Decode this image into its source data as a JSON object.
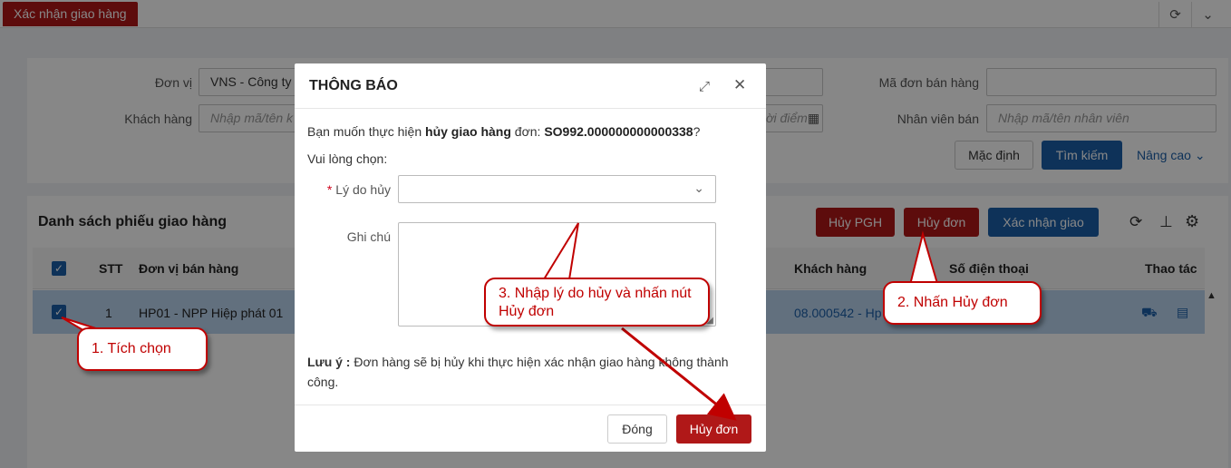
{
  "tabbar": {
    "active_tab": "Xác nhận giao hàng",
    "refresh_icon": "refresh-icon",
    "chevron_icon": "chevron-down-icon"
  },
  "filter": {
    "don_vi_label": "Đơn vị",
    "don_vi_value": "VNS - Công ty",
    "khach_hang_label": "Khách hàng",
    "khach_hang_placeholder": "Nhập mã/tên k",
    "date_placeholder": "ời điểm",
    "ma_don_label": "Mã đơn bán hàng",
    "ma_don_value": "",
    "nhan_vien_label": "Nhân viên bán",
    "nhan_vien_placeholder": "Nhập mã/tên nhân viên",
    "default_button": "Mặc định",
    "search_button": "Tìm kiếm",
    "advanced_link": "Nâng cao"
  },
  "list": {
    "title": "Danh sách phiếu giao hàng",
    "cancel_pgh_button": "Hủy PGH",
    "cancel_order_button": "Hủy đơn",
    "confirm_button": "Xác nhận giao",
    "columns": {
      "stt": "STT",
      "don_vi": "Đơn vị bán hàng",
      "khach_hang": "Khách hàng",
      "sdt": "Số điện thoại",
      "thao_tac": "Thao tác"
    },
    "rows": [
      {
        "stt": "1",
        "don_vi": "HP01 - NPP Hiệp phát 01",
        "khach_hang": "08.000542 - Hp",
        "sdt": ""
      }
    ]
  },
  "modal": {
    "title": "THÔNG BÁO",
    "message_prefix": "Bạn muốn thực hiện ",
    "message_action": "hủy giao hàng",
    "message_mid": " đơn: ",
    "message_order": "SO992.000000000000338",
    "message_suffix": "?",
    "choose_label": "Vui lòng chọn:",
    "reason_label": "Lý do hủy",
    "reason_value": "",
    "note_label": "Ghi chú",
    "note_value": "",
    "warning_bold": "Lưu ý :",
    "warning_text": " Đơn hàng sẽ bị hủy khi thực hiện xác nhận giao hàng không thành công.",
    "close_button": "Đóng",
    "confirm_cancel_button": "Hủy đơn"
  },
  "callouts": {
    "step1": "1. Tích chọn",
    "step2": "2. Nhấn Hủy đơn",
    "step3": "3. Nhập lý do hủy và nhấn nút Hủy đơn"
  },
  "colors": {
    "danger": "#b01818",
    "primary": "#1c5fa8",
    "callout": "#c00000",
    "row_selected": "#b9d3ee"
  }
}
